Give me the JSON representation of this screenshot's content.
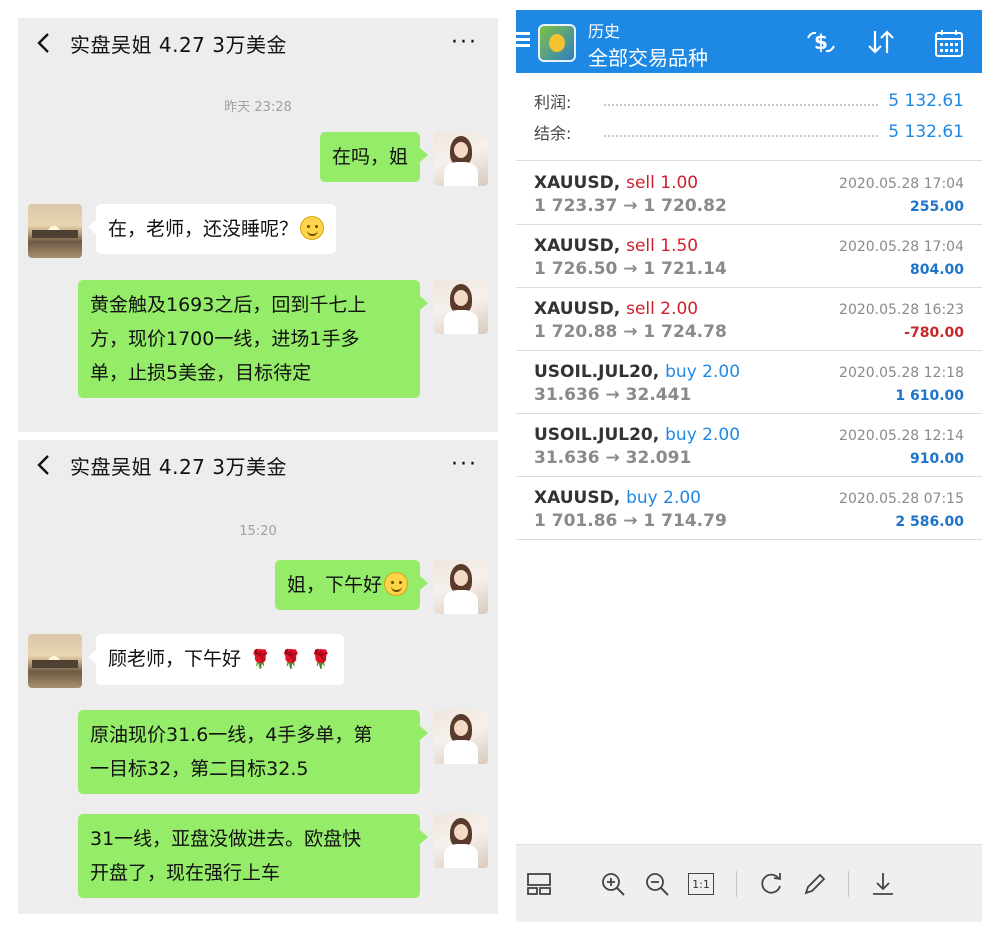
{
  "chat_top": {
    "title": "实盘吴姐   4.27  3万美金",
    "more": "···",
    "timestamp": "昨天 23:28",
    "msg1": "在吗，姐",
    "msg2": "在，老师，还没睡呢？",
    "msg3_line1": "黄金触及1693之后，回到千七上",
    "msg3_line2": "方，现价1700一线，进场1手多",
    "msg3_line3": "单，止损5美金，目标待定"
  },
  "chat_bottom": {
    "title": "实盘吴姐   4.27  3万美金",
    "more": "···",
    "timestamp": "15:20",
    "msg1": "姐，下午好",
    "msg2": "顾老师，下午好",
    "msg3_line1": "原油现价31.6一线，4手多单，第",
    "msg3_line2": "一目标32，第二目标32.5",
    "msg4_line1": "31一线，亚盘没做进去。欧盘快",
    "msg4_line2": "开盘了，现在强行上车"
  },
  "mt": {
    "title_small": "历史",
    "title_large": "全部交易品种",
    "accent_color": "#1e88e5",
    "summary": {
      "profit_label": "利润:",
      "profit_value": "5 132.61",
      "balance_label": "结余:",
      "balance_value": "5 132.61"
    },
    "trades": [
      {
        "symbol": "XAUUSD,",
        "side": "sell 1.00",
        "prices": "1 723.37 → 1 720.82",
        "time": "2020.05.28 17:04",
        "profit": "255.00"
      },
      {
        "symbol": "XAUUSD,",
        "side": "sell 1.50",
        "prices": "1 726.50 → 1 721.14",
        "time": "2020.05.28 17:04",
        "profit": "804.00"
      },
      {
        "symbol": "XAUUSD,",
        "side": "sell 2.00",
        "prices": "1 720.88 → 1 724.78",
        "time": "2020.05.28 16:23",
        "profit": "-780.00"
      },
      {
        "symbol": "USOIL.JUL20,",
        "side": "buy 2.00",
        "prices": "31.636 → 32.441",
        "time": "2020.05.28 12:18",
        "profit": "1 610.00"
      },
      {
        "symbol": "USOIL.JUL20,",
        "side": "buy 2.00",
        "prices": "31.636 → 32.091",
        "time": "2020.05.28 12:14",
        "profit": "910.00"
      },
      {
        "symbol": "XAUUSD,",
        "side": "buy 2.00",
        "prices": "1 701.86 → 1 714.79",
        "time": "2020.05.28 07:15",
        "profit": "2 586.00"
      }
    ],
    "toolbar": {
      "ratio_label": "1:1"
    }
  }
}
